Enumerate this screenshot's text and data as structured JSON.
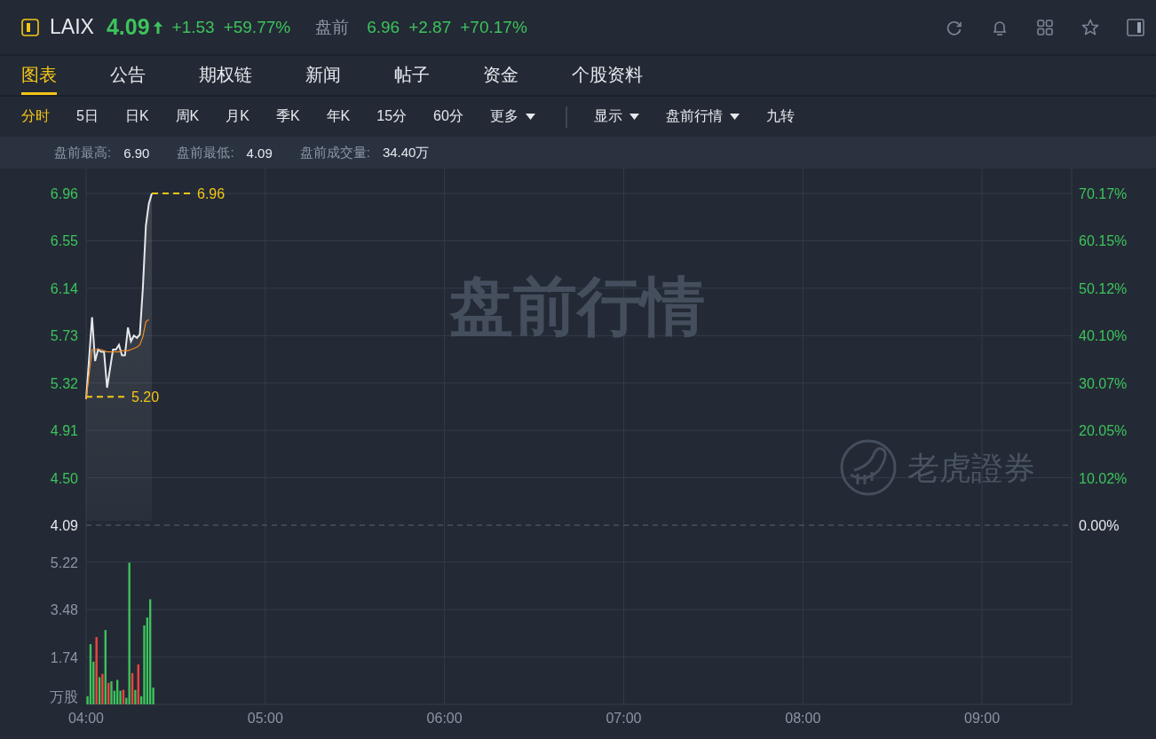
{
  "header": {
    "symbol": "LAIX",
    "price": "4.09",
    "change": "+1.53",
    "change_pct": "+59.77%",
    "session_label": "盘前",
    "session_price": "6.96",
    "session_change": "+2.87",
    "session_change_pct": "+70.17%"
  },
  "tabs": [
    {
      "label": "图表",
      "selected": true
    },
    {
      "label": "公告",
      "selected": false
    },
    {
      "label": "期权链",
      "selected": false
    },
    {
      "label": "新闻",
      "selected": false
    },
    {
      "label": "帖子",
      "selected": false
    },
    {
      "label": "资金",
      "selected": false
    },
    {
      "label": "个股资料",
      "selected": false
    }
  ],
  "periods": [
    {
      "label": "分时",
      "selected": true,
      "dropdown": false
    },
    {
      "label": "5日",
      "selected": false,
      "dropdown": false
    },
    {
      "label": "日K",
      "selected": false,
      "dropdown": false
    },
    {
      "label": "周K",
      "selected": false,
      "dropdown": false
    },
    {
      "label": "月K",
      "selected": false,
      "dropdown": false
    },
    {
      "label": "季K",
      "selected": false,
      "dropdown": false
    },
    {
      "label": "年K",
      "selected": false,
      "dropdown": false
    },
    {
      "label": "15分",
      "selected": false,
      "dropdown": false
    },
    {
      "label": "60分",
      "selected": false,
      "dropdown": false
    },
    {
      "label": "更多",
      "selected": false,
      "dropdown": true
    }
  ],
  "options": [
    {
      "label": "显示",
      "dropdown": true
    },
    {
      "label": "盘前行情",
      "dropdown": true
    },
    {
      "label": "九转",
      "dropdown": false
    }
  ],
  "stats": [
    {
      "label": "盘前最高:",
      "value": "6.90"
    },
    {
      "label": "盘前最低:",
      "value": "4.09"
    },
    {
      "label": "盘前成交量:",
      "value": "34.40万"
    }
  ],
  "price_chart": {
    "watermark": "盘前行情",
    "brand": "老虎證券",
    "right_labels": [
      "70.17%",
      "60.15%",
      "50.12%",
      "40.10%",
      "30.07%",
      "20.05%",
      "10.02%",
      "0.00%"
    ],
    "chart_data": {
      "type": "line",
      "x": [
        4,
        4.0333,
        4.05,
        4.0667,
        4.0833,
        4.1,
        4.1167,
        4.15,
        4.1667,
        4.1833,
        4.2,
        4.2167,
        4.2333,
        4.25,
        4.2667,
        4.2833,
        4.3,
        4.3167,
        4.3333,
        4.35,
        4.3667
      ],
      "series": [
        {
          "color": "#e6e8ec",
          "values": [
            5.18,
            5.89,
            5.51,
            5.61,
            5.59,
            5.59,
            5.28,
            5.61,
            5.61,
            5.65,
            5.56,
            5.56,
            5.8,
            5.68,
            5.73,
            5.71,
            5.74,
            6.14,
            6.68,
            6.87,
            6.96
          ]
        },
        {
          "color": "#f08c28",
          "values": [
            5.18,
            5.61,
            5.61,
            5.61,
            5.61,
            5.6,
            5.59,
            5.59,
            5.59,
            5.59,
            5.6,
            5.6,
            5.6,
            5.61,
            5.62,
            5.63,
            5.65,
            5.72,
            5.85,
            5.87,
            null
          ]
        }
      ],
      "xlim": [
        4,
        9.5
      ],
      "ylim": [
        4.09,
        7.16
      ],
      "grid": true,
      "yticks": [
        {
          "value": 6.96,
          "label": "6.96"
        },
        {
          "value": 6.55,
          "label": "6.55"
        },
        {
          "value": 6.14,
          "label": "6.14"
        },
        {
          "value": 5.73,
          "label": "5.73"
        },
        {
          "value": 5.32,
          "label": "5.32"
        },
        {
          "value": 4.91,
          "label": "4.91"
        },
        {
          "value": 4.5,
          "label": "4.50"
        },
        {
          "value": 4.09,
          "label": "4.09"
        }
      ],
      "annotations": [
        {
          "text": "6.96",
          "x": 4.3667,
          "y": 6.96
        },
        {
          "text": "5.20",
          "x": 4,
          "y": 5.2
        }
      ]
    }
  },
  "volume_chart": {
    "chart_data": {
      "type": "bar",
      "x": [
        4,
        4.0167,
        4.0333,
        4.05,
        4.0667,
        4.0833,
        4.1,
        4.1167,
        4.1333,
        4.15,
        4.1667,
        4.1833,
        4.2,
        4.2167,
        4.2333,
        4.25,
        4.2667,
        4.2833,
        4.3,
        4.3167,
        4.3333,
        4.35,
        4.3667
      ],
      "stacked": true,
      "ylabel": "万股",
      "series": [
        {
          "color": "#3dc35c",
          "values": [
            0.3,
            2.21,
            1.57,
            null,
            1.0,
            null,
            2.73,
            null,
            0.85,
            0.5,
            0.9,
            0.5,
            null,
            0.24,
            5.2,
            null,
            0.53,
            null,
            0.3,
            2.9,
            3.19,
            3.86,
            0.62
          ]
        },
        {
          "color": "#f0443c",
          "values": [
            null,
            null,
            null,
            2.47,
            null,
            1.12,
            null,
            0.79,
            null,
            null,
            null,
            null,
            0.54,
            null,
            null,
            1.15,
            null,
            1.47,
            null,
            null,
            null,
            null,
            null
          ]
        }
      ],
      "xlim": [
        4,
        9.5
      ],
      "ylim": [
        0,
        5.22
      ],
      "grid": true,
      "xticks": [
        {
          "value": 4,
          "label": "04:00"
        },
        {
          "value": 5,
          "label": "05:00"
        },
        {
          "value": 6,
          "label": "06:00"
        },
        {
          "value": 7,
          "label": "07:00"
        },
        {
          "value": 8,
          "label": "08:00"
        },
        {
          "value": 9,
          "label": "09:00"
        }
      ],
      "yticks": [
        {
          "value": 1.74,
          "label": "1.74"
        },
        {
          "value": 3.48,
          "label": "3.48"
        },
        {
          "value": 5.22,
          "label": "5.22"
        }
      ]
    }
  }
}
